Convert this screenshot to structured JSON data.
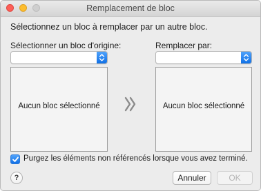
{
  "window": {
    "title": "Remplacement de bloc"
  },
  "instruction": "Sélectionnez un bloc à remplacer par un autre bloc.",
  "source": {
    "label": "Sélectionner un bloc d'origine:",
    "popup_value": "",
    "empty_text": "Aucun bloc sélectionné"
  },
  "target": {
    "label": "Remplacer par:",
    "popup_value": "",
    "empty_text": "Aucun bloc sélectionné"
  },
  "purge": {
    "label": "Purgez les éléments non référencés lorsque vous avez terminé.",
    "checked": true
  },
  "buttons": {
    "help": "?",
    "cancel": "Annuler",
    "ok": "OK"
  },
  "icons": {
    "arrow": "double-chevron-right-icon",
    "popup": "updown-arrows-icon"
  },
  "colors": {
    "accent": "#1070e6"
  }
}
